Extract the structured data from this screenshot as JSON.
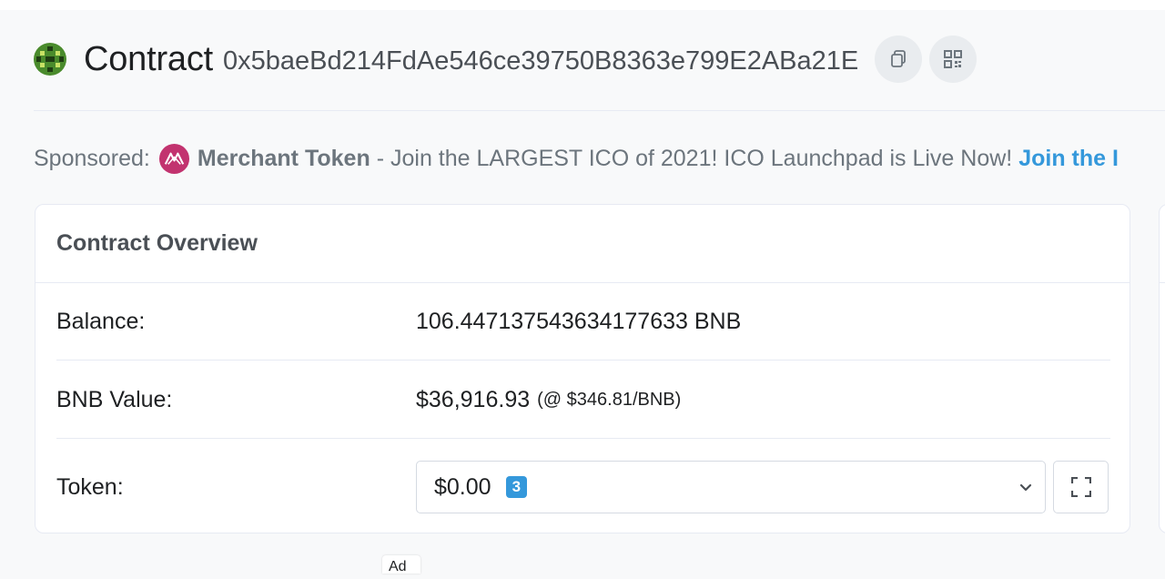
{
  "header": {
    "title": "Contract",
    "address": "0x5baeBd214FdAe546ce39750B8363e799E2ABa21E",
    "icons": {
      "avatar": "identicon-avatar",
      "copy": "copy-icon",
      "qr": "qr-code-icon"
    }
  },
  "sponsored": {
    "label": "Sponsored:",
    "name": "Merchant Token",
    "text": "- Join the LARGEST ICO of 2021! ICO Launchpad is Live Now!",
    "cta": "Join the I",
    "logo_color": "#c2336f"
  },
  "overview": {
    "title": "Contract Overview",
    "balance": {
      "label": "Balance:",
      "value": "106.447137543634177633 BNB"
    },
    "bnb_value": {
      "label": "BNB Value:",
      "value": "$36,916.93",
      "price_note": "(@ $346.81/BNB)"
    },
    "token": {
      "label": "Token:",
      "value": "$0.00",
      "count": "3"
    }
  },
  "ad": {
    "label": "Ad"
  },
  "colors": {
    "accent": "#3498db",
    "border": "#e7eaf3",
    "text": "#1e2022",
    "muted": "#6c757d"
  }
}
